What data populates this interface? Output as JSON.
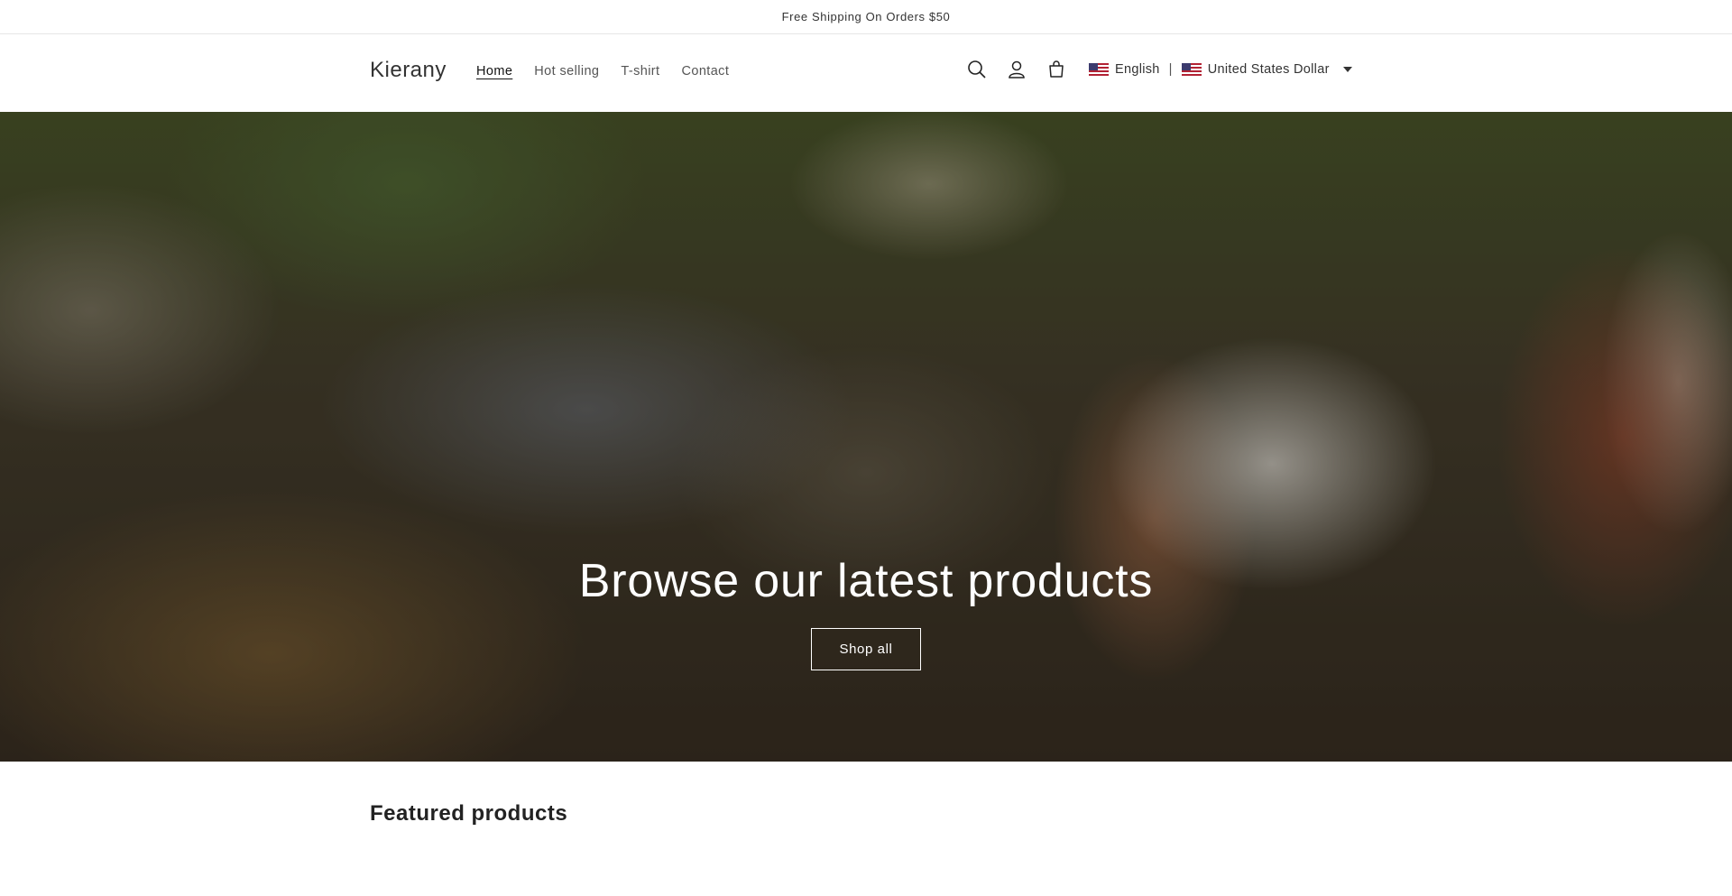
{
  "announcement": {
    "text": "Free Shipping On Orders $50"
  },
  "header": {
    "logo": "Kierany",
    "nav": [
      {
        "label": "Home",
        "active": true
      },
      {
        "label": "Hot selling",
        "active": false
      },
      {
        "label": "T-shirt",
        "active": false
      },
      {
        "label": "Contact",
        "active": false
      }
    ],
    "icons": [
      "search-icon",
      "account-icon",
      "cart-icon"
    ],
    "localization": {
      "language": "English",
      "separator": "|",
      "currency": "United States Dollar",
      "flag": "us-flag-icon"
    }
  },
  "hero": {
    "title": "Browse our latest products",
    "button_label": "Shop all"
  },
  "featured": {
    "heading": "Featured products"
  }
}
